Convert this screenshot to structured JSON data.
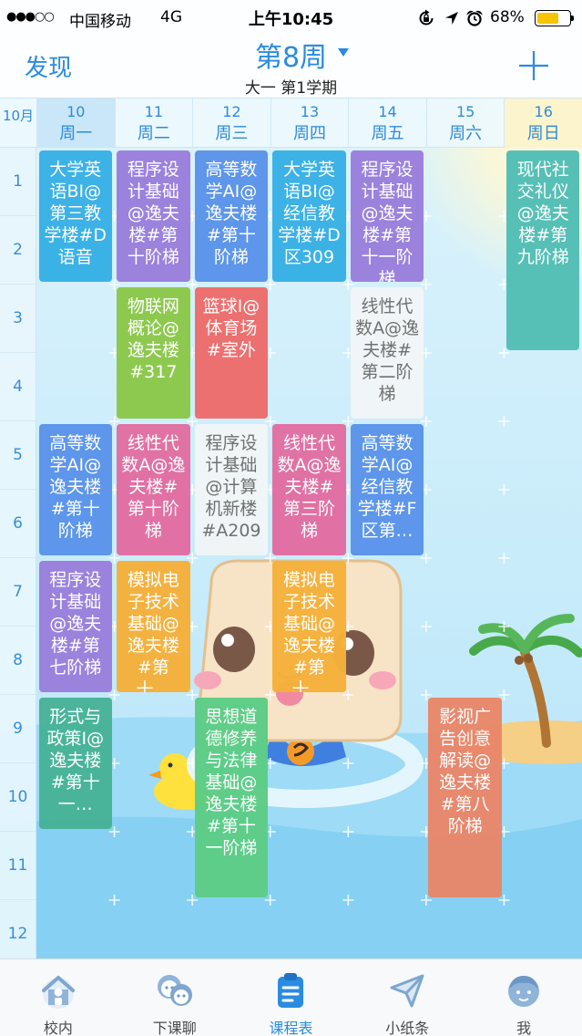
{
  "status_bar": {
    "signal": "●●●○○",
    "carrier": "中国移动",
    "network": "4G",
    "time": "上午10:45",
    "battery": "68%",
    "battery_level": 0.68,
    "icons": [
      "rotation-lock-icon",
      "location-icon",
      "alarm-icon",
      "battery-icon"
    ]
  },
  "nav": {
    "left_label": "发现",
    "week_title": "第8周",
    "week_dropdown_icon": "caret-down-icon",
    "term": "大一 第1学期",
    "add_icon": "plus-icon"
  },
  "header": {
    "month": "10月",
    "days": [
      {
        "date": "10",
        "name": "周一",
        "highlight": "#c9e7f8"
      },
      {
        "date": "11",
        "name": "周二"
      },
      {
        "date": "12",
        "name": "周三"
      },
      {
        "date": "13",
        "name": "周四"
      },
      {
        "date": "14",
        "name": "周五"
      },
      {
        "date": "15",
        "name": "周六"
      },
      {
        "date": "16",
        "name": "周日",
        "highlight": "#fcf4cc"
      }
    ]
  },
  "periods": [
    "1",
    "2",
    "3",
    "4",
    "5",
    "6",
    "7",
    "8",
    "9",
    "10",
    "11",
    "12"
  ],
  "courses": [
    {
      "day": "周一",
      "start": 1,
      "end": 2,
      "text": "大学英语BI@第三教学楼#D语音",
      "color": "#37b0e6"
    },
    {
      "day": "周一",
      "start": 5,
      "end": 6,
      "text": "高等数学AI@逸夫楼#第十阶梯",
      "color": "#5a94ea"
    },
    {
      "day": "周一",
      "start": 7,
      "end": 8,
      "text": "程序设计基础@逸夫楼#第七阶梯",
      "color": "#9a7fdd"
    },
    {
      "day": "周一",
      "start": 9,
      "end": 10,
      "text": "形式与政策Ⅰ@逸夫楼#第十一…",
      "color": "#48b398"
    },
    {
      "day": "周二",
      "start": 1,
      "end": 2,
      "text": "程序设计基础@逸夫楼#第十阶梯",
      "color": "#9a7fdd"
    },
    {
      "day": "周二",
      "start": 3,
      "end": 4,
      "text": "物联网概论@逸夫楼#317",
      "color": "#8cc84a"
    },
    {
      "day": "周二",
      "start": 5,
      "end": 6,
      "text": "线性代数A@逸夫楼#第十阶梯",
      "color": "#e26ea2"
    },
    {
      "day": "周二",
      "start": 7,
      "end": 8,
      "text": "模拟电子技术基础@逸夫楼#第十…",
      "color": "#f5b13b"
    },
    {
      "day": "周三",
      "start": 1,
      "end": 2,
      "text": "高等数学AI@逸夫楼#第十阶梯",
      "color": "#5a94ea"
    },
    {
      "day": "周三",
      "start": 3,
      "end": 4,
      "text": "篮球Ⅰ@体育场#室外",
      "color": "#ee6c6c"
    },
    {
      "day": "周三",
      "start": 5,
      "end": 6,
      "text": "程序设计基础@计算机新楼#A209",
      "inactive": true
    },
    {
      "day": "周三",
      "start": 9,
      "end": 11,
      "text": "思想道德修养与法律基础@逸夫楼#第十一阶梯",
      "color": "#5ccd86"
    },
    {
      "day": "周四",
      "start": 1,
      "end": 2,
      "text": "大学英语BI@经信教学楼#D区309",
      "color": "#37b0e6"
    },
    {
      "day": "周四",
      "start": 5,
      "end": 6,
      "text": "线性代数A@逸夫楼#第三阶梯",
      "color": "#e26ea2"
    },
    {
      "day": "周四",
      "start": 7,
      "end": 8,
      "text": "模拟电子技术基础@逸夫楼#第十…",
      "color": "#f5b13b"
    },
    {
      "day": "周五",
      "start": 1,
      "end": 2,
      "text": "程序设计基础@逸夫楼#第十一阶梯",
      "color": "#9a7fdd"
    },
    {
      "day": "周五",
      "start": 3,
      "end": 4,
      "text": "线性代数A@逸夫楼#第二阶梯",
      "inactive": true
    },
    {
      "day": "周五",
      "start": 5,
      "end": 6,
      "text": "高等数学AI@经信教学楼#F区第…",
      "color": "#5a94ea"
    },
    {
      "day": "周六",
      "start": 9,
      "end": 11,
      "text": "影视广告创意解读@逸夫楼#第八阶梯",
      "color": "#e9876a"
    },
    {
      "day": "周日",
      "start": 1,
      "end": 3,
      "text": "现代社交礼仪@逸夫楼#第九阶梯",
      "color": "#52bfb5"
    }
  ],
  "tabs": [
    {
      "label": "校内",
      "icon": "campus-icon"
    },
    {
      "label": "下课聊",
      "icon": "chat-icon"
    },
    {
      "label": "课程表",
      "icon": "timetable-icon",
      "active": true
    },
    {
      "label": "小纸条",
      "icon": "paper-plane-icon"
    },
    {
      "label": "我",
      "icon": "profile-icon"
    }
  ],
  "colors": {
    "accent": "#2a8be2",
    "header_text": "#2f8bd8",
    "inactive_course_bg": "#f6f6f6",
    "inactive_course_text": "#6d6d6d",
    "tab_inactive_icon": "#8fb3d9"
  }
}
